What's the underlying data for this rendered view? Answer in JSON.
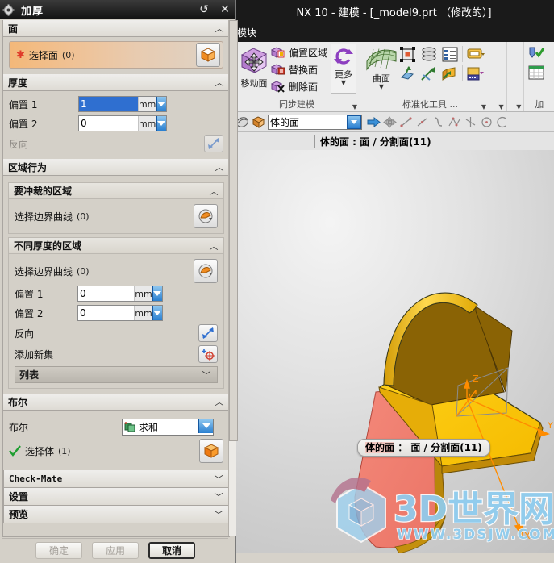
{
  "app": {
    "title": "NX 10 - 建模 - [_model9.prt （修改的）]",
    "menu_label": "模块"
  },
  "ribbon": {
    "groups": [
      {
        "name": "同步建模",
        "big": {
          "label": "移动面",
          "icon": "move-face-icon"
        },
        "items": [
          {
            "label": "偏置区域",
            "icon": "offset-region-icon"
          },
          {
            "label": "替换面",
            "icon": "replace-face-icon"
          },
          {
            "label": "删除面",
            "icon": "delete-face-icon"
          }
        ],
        "more": {
          "label": "更多",
          "icon": "more-icon"
        }
      },
      {
        "name": "标准化工具 ...",
        "big": {
          "label": "曲面",
          "icon": "surface-icon"
        },
        "items": []
      },
      {
        "name": "加",
        "big": {
          "label": "",
          "icon": ""
        },
        "items": []
      }
    ]
  },
  "selection_bar": {
    "scope_value": "体的面",
    "filter_icon": "face-filter-icon",
    "body_icon": "solid-body-icon",
    "arrow_icon": "arrow-right-icon"
  },
  "cue_bar": {
    "text": "体的面 : 面 / 分割面(11)"
  },
  "graphics": {
    "tooltip": "体的面 : 面 / 分割面(11)",
    "tooltip_highlight": "体的面",
    "axis_labels": [
      "Z",
      "Y",
      "X"
    ],
    "colors": {
      "selected_face": "#f0806f",
      "body_face": "#ffc800",
      "body_shade": "#c38f06",
      "accent_orange": "#ff9100"
    },
    "watermark": {
      "text": "3D世界网",
      "url": "WWW.3DSJW.COM"
    }
  },
  "dialog": {
    "title": "加厚",
    "title_icon": "gear-icon",
    "reset_icon": "reset-icon",
    "close_icon": "close-icon",
    "sections": [
      {
        "id": "face",
        "title": "面",
        "expanded": true,
        "select_label": "选择面",
        "select_count": "(0)",
        "select_required": true,
        "select_icon": "select-face-cube-icon"
      },
      {
        "id": "thickness",
        "title": "厚度",
        "expanded": true,
        "offset1_label": "偏置 1",
        "offset1_value": "1",
        "offset1_unit": "mm",
        "offset2_label": "偏置 2",
        "offset2_value": "0",
        "offset2_unit": "mm",
        "reverse_label": "反向",
        "reverse_icon": "reverse-direction-icon",
        "reverse_disabled": true
      },
      {
        "id": "region-behavior",
        "title": "区域行为",
        "expanded": true,
        "sub": [
          {
            "id": "pierce-region",
            "title": "要冲裁的区域",
            "select_label": "选择边界曲线",
            "select_count": "(0)",
            "select_icon": "curve-select-icon"
          },
          {
            "id": "varying-thickness",
            "title": "不同厚度的区域",
            "select_label": "选择边界曲线",
            "select_count": "(0)",
            "select_icon": "curve-select-icon",
            "offset1_label": "偏置 1",
            "offset1_value": "0",
            "offset1_unit": "mm",
            "offset2_label": "偏置 2",
            "offset2_value": "0",
            "offset2_unit": "mm",
            "reverse_label": "反向",
            "reverse_icon": "reverse-direction-icon",
            "addset_label": "添加新集",
            "addset_icon": "add-new-set-icon",
            "list_label": "列表"
          }
        ]
      },
      {
        "id": "boolean",
        "title": "布尔",
        "expanded": true,
        "boolean_label": "布尔",
        "boolean_value": "求和",
        "boolean_icon": "unite-icon",
        "select_body_label": "选择体",
        "select_body_count": "(1)",
        "select_body_check": "check-icon",
        "select_body_icon": "select-body-cube-icon"
      }
    ],
    "collapsed_sections": [
      {
        "id": "check-mate",
        "title": "Check-Mate",
        "mono": true
      },
      {
        "id": "settings",
        "title": "设置",
        "mono": false
      },
      {
        "id": "preview",
        "title": "预览",
        "mono": false
      }
    ],
    "footer": {
      "ok_label": "确定",
      "ok_disabled": true,
      "apply_label": "应用",
      "apply_disabled": true,
      "cancel_label": "取消",
      "cancel_disabled": false
    }
  }
}
